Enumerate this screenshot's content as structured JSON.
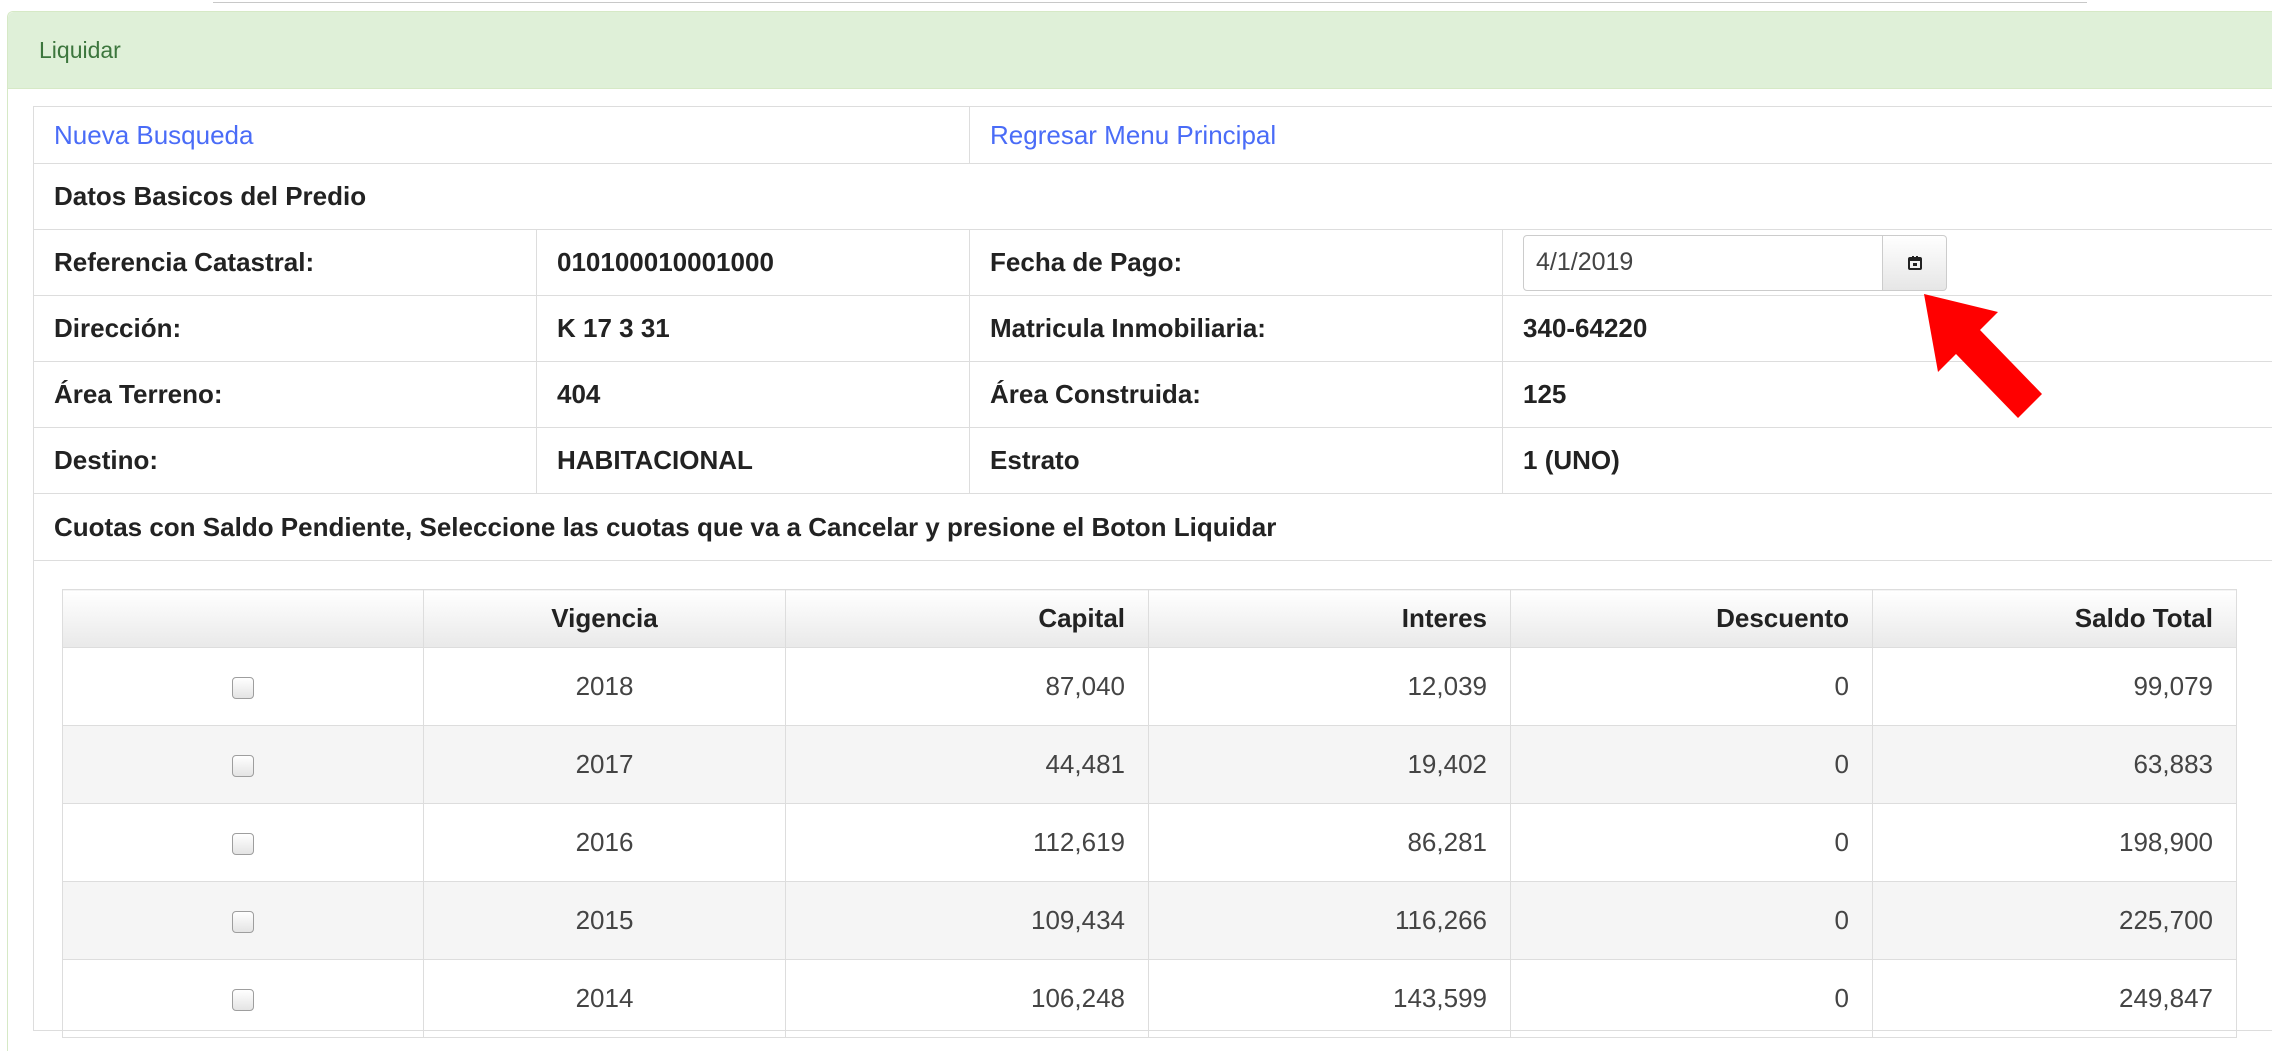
{
  "panel": {
    "title": "Liquidar"
  },
  "links": {
    "new_search": "Nueva Busqueda",
    "back_main": "Regresar Menu Principal"
  },
  "section": {
    "title": "Datos Basicos del Predio"
  },
  "predio": {
    "ref_label": "Referencia Catastral:",
    "ref_value": "010100010001000",
    "fecha_label": "Fecha de Pago:",
    "fecha_value": "4/1/2019",
    "dir_label": "Dirección:",
    "dir_value": "K 17 3 31",
    "matricula_label": "Matricula Inmobiliaria:",
    "matricula_value": "340-64220",
    "area_terreno_label": "Área Terreno:",
    "area_terreno_value": "404",
    "area_construida_label": "Área Construida:",
    "area_construida_value": "125",
    "destino_label": "Destino:",
    "destino_value": "HABITACIONAL",
    "estrato_label": "Estrato",
    "estrato_value": "1 (UNO)"
  },
  "cuotas": {
    "instruction": "Cuotas con Saldo Pendiente, Seleccione las cuotas que va a Cancelar y presione el Boton Liquidar",
    "headers": [
      "",
      "Vigencia",
      "Capital",
      "Interes",
      "Descuento",
      "Saldo Total"
    ],
    "rows": [
      {
        "vigencia": "2018",
        "capital": "87,040",
        "interes": "12,039",
        "descuento": "0",
        "saldo": "99,079",
        "checked": false
      },
      {
        "vigencia": "2017",
        "capital": "44,481",
        "interes": "19,402",
        "descuento": "0",
        "saldo": "63,883",
        "checked": false
      },
      {
        "vigencia": "2016",
        "capital": "112,619",
        "interes": "86,281",
        "descuento": "0",
        "saldo": "198,900",
        "checked": false
      },
      {
        "vigencia": "2015",
        "capital": "109,434",
        "interes": "116,266",
        "descuento": "0",
        "saldo": "225,700",
        "checked": false
      },
      {
        "vigencia": "2014",
        "capital": "106,248",
        "interes": "143,599",
        "descuento": "0",
        "saldo": "249,847",
        "checked": false
      }
    ]
  },
  "icons": {
    "calendar": "calendar-icon",
    "annotation": "red-arrow-annotation",
    "checkbox": "checkbox"
  },
  "colors": {
    "heading_bg": "#dff0d8",
    "heading_text": "#3c763d",
    "link": "#4a6cf7",
    "arrow": "#ff0000"
  }
}
